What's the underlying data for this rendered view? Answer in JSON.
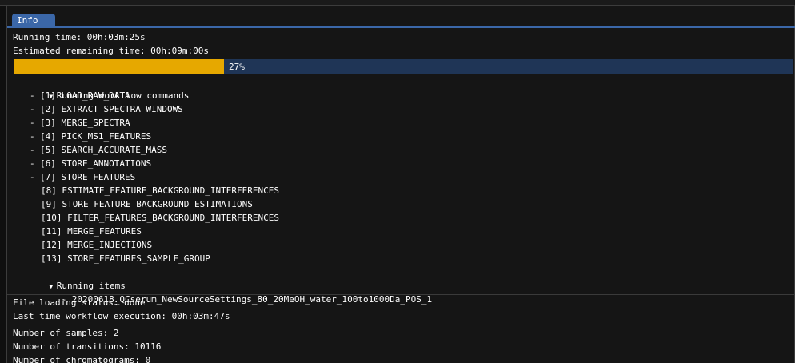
{
  "tab": {
    "label": "Info"
  },
  "status": {
    "running_time": "Running time: 00h:03m:25s",
    "remaining_time": "Estimated remaining time: 00h:09m:00s",
    "progress_fraction": 0.27,
    "progress_label": "27%"
  },
  "commands": {
    "header": "Running workflow commands",
    "items": [
      {
        "label": "[1] LOAD_RAW_DATA",
        "running": true
      },
      {
        "label": "[2] EXTRACT_SPECTRA_WINDOWS",
        "running": true
      },
      {
        "label": "[3] MERGE_SPECTRA",
        "running": true
      },
      {
        "label": "[4] PICK_MS1_FEATURES",
        "running": true
      },
      {
        "label": "[5] SEARCH_ACCURATE_MASS",
        "running": true
      },
      {
        "label": "[6] STORE_ANNOTATIONS",
        "running": true
      },
      {
        "label": "[7] STORE_FEATURES",
        "running": true
      },
      {
        "label": "[8] ESTIMATE_FEATURE_BACKGROUND_INTERFERENCES",
        "running": false
      },
      {
        "label": "[9] STORE_FEATURE_BACKGROUND_ESTIMATIONS",
        "running": false
      },
      {
        "label": "[10] FILTER_FEATURES_BACKGROUND_INTERFERENCES",
        "running": false
      },
      {
        "label": "[11] MERGE_FEATURES",
        "running": false
      },
      {
        "label": "[12] MERGE_INJECTIONS",
        "running": false
      },
      {
        "label": "[13] STORE_FEATURES_SAMPLE_GROUP",
        "running": false
      }
    ]
  },
  "items": {
    "header": "Running items",
    "list": [
      "20200618_QCserum_NewSourceSettings_80_20MeOH_water_100to1000Da_POS_1"
    ]
  },
  "file_status": {
    "loading": "File loading status: done",
    "last_execution": "Last time workflow execution: 00h:03m:47s"
  },
  "counts": {
    "samples": "Number of samples: 2",
    "transitions": "Number of transitions: 10116",
    "chromatograms": "Number of chromatograms: 0"
  },
  "colors": {
    "tab": "#3b67a8",
    "progress_fill": "#e6a800",
    "progress_bg": "#1f3556"
  },
  "icons": {
    "expanded": "triangle-down-icon"
  }
}
